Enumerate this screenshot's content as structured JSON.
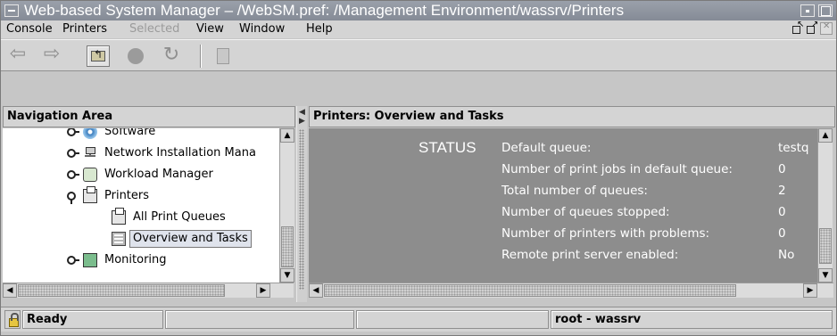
{
  "window": {
    "title": "Web-based System Manager – /WebSM.pref: /Management Environment/wassrv/Printers"
  },
  "menu": {
    "items": [
      {
        "label": "Console",
        "enabled": true
      },
      {
        "label": "Printers",
        "enabled": true
      },
      {
        "label": "Selected",
        "enabled": false
      },
      {
        "label": "View",
        "enabled": true
      },
      {
        "label": "Window",
        "enabled": true
      },
      {
        "label": "Help",
        "enabled": true
      }
    ]
  },
  "toolbar": {
    "buttons": [
      {
        "name": "back",
        "icon": "left-arrow-icon",
        "enabled": false
      },
      {
        "name": "forward",
        "icon": "right-arrow-icon",
        "enabled": false
      },
      {
        "name": "up-level",
        "icon": "folder-up-icon",
        "enabled": true
      },
      {
        "name": "stop",
        "icon": "stop-icon",
        "enabled": false
      },
      {
        "name": "refresh",
        "icon": "refresh-icon",
        "enabled": true
      },
      {
        "name": "properties",
        "icon": "properties-icon",
        "enabled": false
      }
    ]
  },
  "navigation": {
    "title": "Navigation Area",
    "tree": [
      {
        "label": "Software",
        "icon": "gear-icon",
        "expander": "collapsed"
      },
      {
        "label": "Network Installation Mana",
        "icon": "network-install-icon",
        "expander": "collapsed"
      },
      {
        "label": "Workload Manager",
        "icon": "workload-manager-icon",
        "expander": "collapsed"
      },
      {
        "label": "Printers",
        "icon": "printer-icon",
        "expander": "expanded"
      },
      {
        "label": "All Print Queues",
        "icon": "printer-icon",
        "expander": "none"
      },
      {
        "label": "Overview and Tasks",
        "icon": "overview-icon",
        "expander": "none",
        "selected": true
      },
      {
        "label": "Monitoring",
        "icon": "monitor-icon",
        "expander": "collapsed"
      }
    ]
  },
  "main": {
    "title": "Printers: Overview and Tasks",
    "status_label": "STATUS",
    "rows": [
      {
        "label": "Default queue:",
        "value": "testq"
      },
      {
        "label": "Number of print jobs in default queue:",
        "value": "0"
      },
      {
        "label": "Total number of queues:",
        "value": "2"
      },
      {
        "label": "Number of queues stopped:",
        "value": "0"
      },
      {
        "label": "Number of printers with problems:",
        "value": "0"
      },
      {
        "label": "Remote print server enabled:",
        "value": "No"
      }
    ]
  },
  "statusbar": {
    "status_text": "Ready",
    "user_host": "root - wassrv"
  },
  "colors": {
    "titlebar": "#8a909b",
    "panel_background": "#8d8d8d",
    "chrome": "#d4d4d4"
  }
}
